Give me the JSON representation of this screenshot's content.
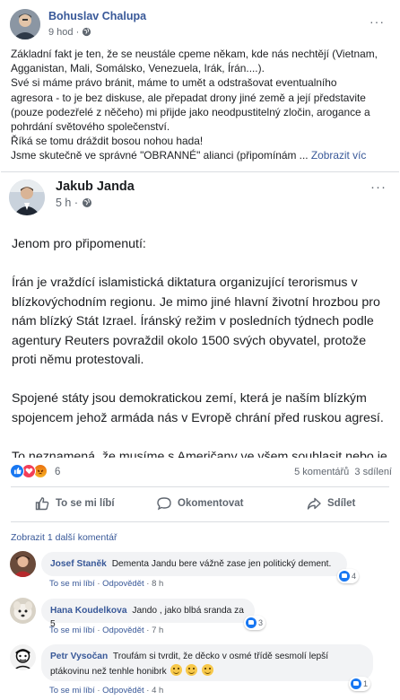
{
  "post": {
    "author": "Bohuslav Chalupa",
    "time": "9 hod",
    "privacy_sep": "·",
    "more_label": "···",
    "lines": [
      "Základní fakt je ten, že se neustále cpeme někam, kde nás nechtějí (Vietnam,",
      "Agganistan, Mali, Somálsko, Venezuela, Irák, Írán....).",
      "Své si máme právo bránit, máme to umět a odstrašovat eventualního",
      "agresora - to je bez diskuse, ale přepadat drony jiné země a její představite",
      "(pouze podezřelé z něčeho) mi přijde jako neodpustitelný zločin, arogance a",
      "pohrdání světového společenství.",
      "Říká se tomu dráždit bosou nohou hada!"
    ],
    "last_line": "Jsme skutečně ve správné \"OBRANNÉ\" alianci (připomínám ... ",
    "see_more": "Zobrazit víc"
  },
  "shared": {
    "author": "Jakub Janda",
    "time": "5 h",
    "privacy_sep": "·",
    "more_label": "···",
    "paragraphs": [
      "Jenom pro připomenutí:",
      "Írán je vraždící islamistická diktatura organizující terorismus v blízkovýchodním regionu. Je mimo jiné hlavní životní hrozbou pro nám blízký Stát Izrael. Íránský režim v posledních týdnech podle agentury Reuters povraždil okolo 1500 svých obyvatel, protože proti němu protestovali.",
      "Spojené státy jsou demokratickou zemí, která je naším blízkým spojencem jehož armáda nás v Evropě chrání před ruskou agresí.",
      "To neznamená, že musíme s Američany ve všem souhlasit nebo je bezhlavě v každém kroku podporovat, ale je dobré si říct základní fakty."
    ]
  },
  "reactions": {
    "count": "6",
    "comments": "5 komentářů",
    "shares": "3 sdílení"
  },
  "actions": {
    "like": "To se mi líbí",
    "comment": "Okomentovat",
    "share": "Sdílet"
  },
  "view_more": "Zobrazit 1 další komentář",
  "comments": [
    {
      "name": "Josef Staněk",
      "text": "Dementa Jandu bere vážně zase jen politický dement.",
      "like": "To se mi líbí",
      "reply": "Odpovědět",
      "time": "8 h",
      "reaction_count": "4"
    },
    {
      "name": "Hana Koudelkova",
      "text": "Jando , jako blbá sranda za 5",
      "like": "To se mi líbí",
      "reply": "Odpovědět",
      "time": "7 h",
      "reaction_count": "3"
    },
    {
      "name": "Petr Vysočan",
      "text1": "Troufám si tvrdit, že děcko v osmé třídě sesmolí lepší",
      "text2": "ptákovinu než tenhle honibrk",
      "like": "To se mi líbí",
      "reply": "Odpovědět",
      "time": "4 h",
      "reaction_count": "1"
    }
  ],
  "sep": "·",
  "colors": {
    "link": "#385898",
    "like_blue": "#1877f2",
    "love_red": "#f33e58",
    "text_gray": "#606770"
  },
  "icons": [
    "globe-icon",
    "like-icon",
    "love-icon",
    "angry-icon",
    "comment-icon",
    "share-icon",
    "smile-emoji-icon"
  ]
}
